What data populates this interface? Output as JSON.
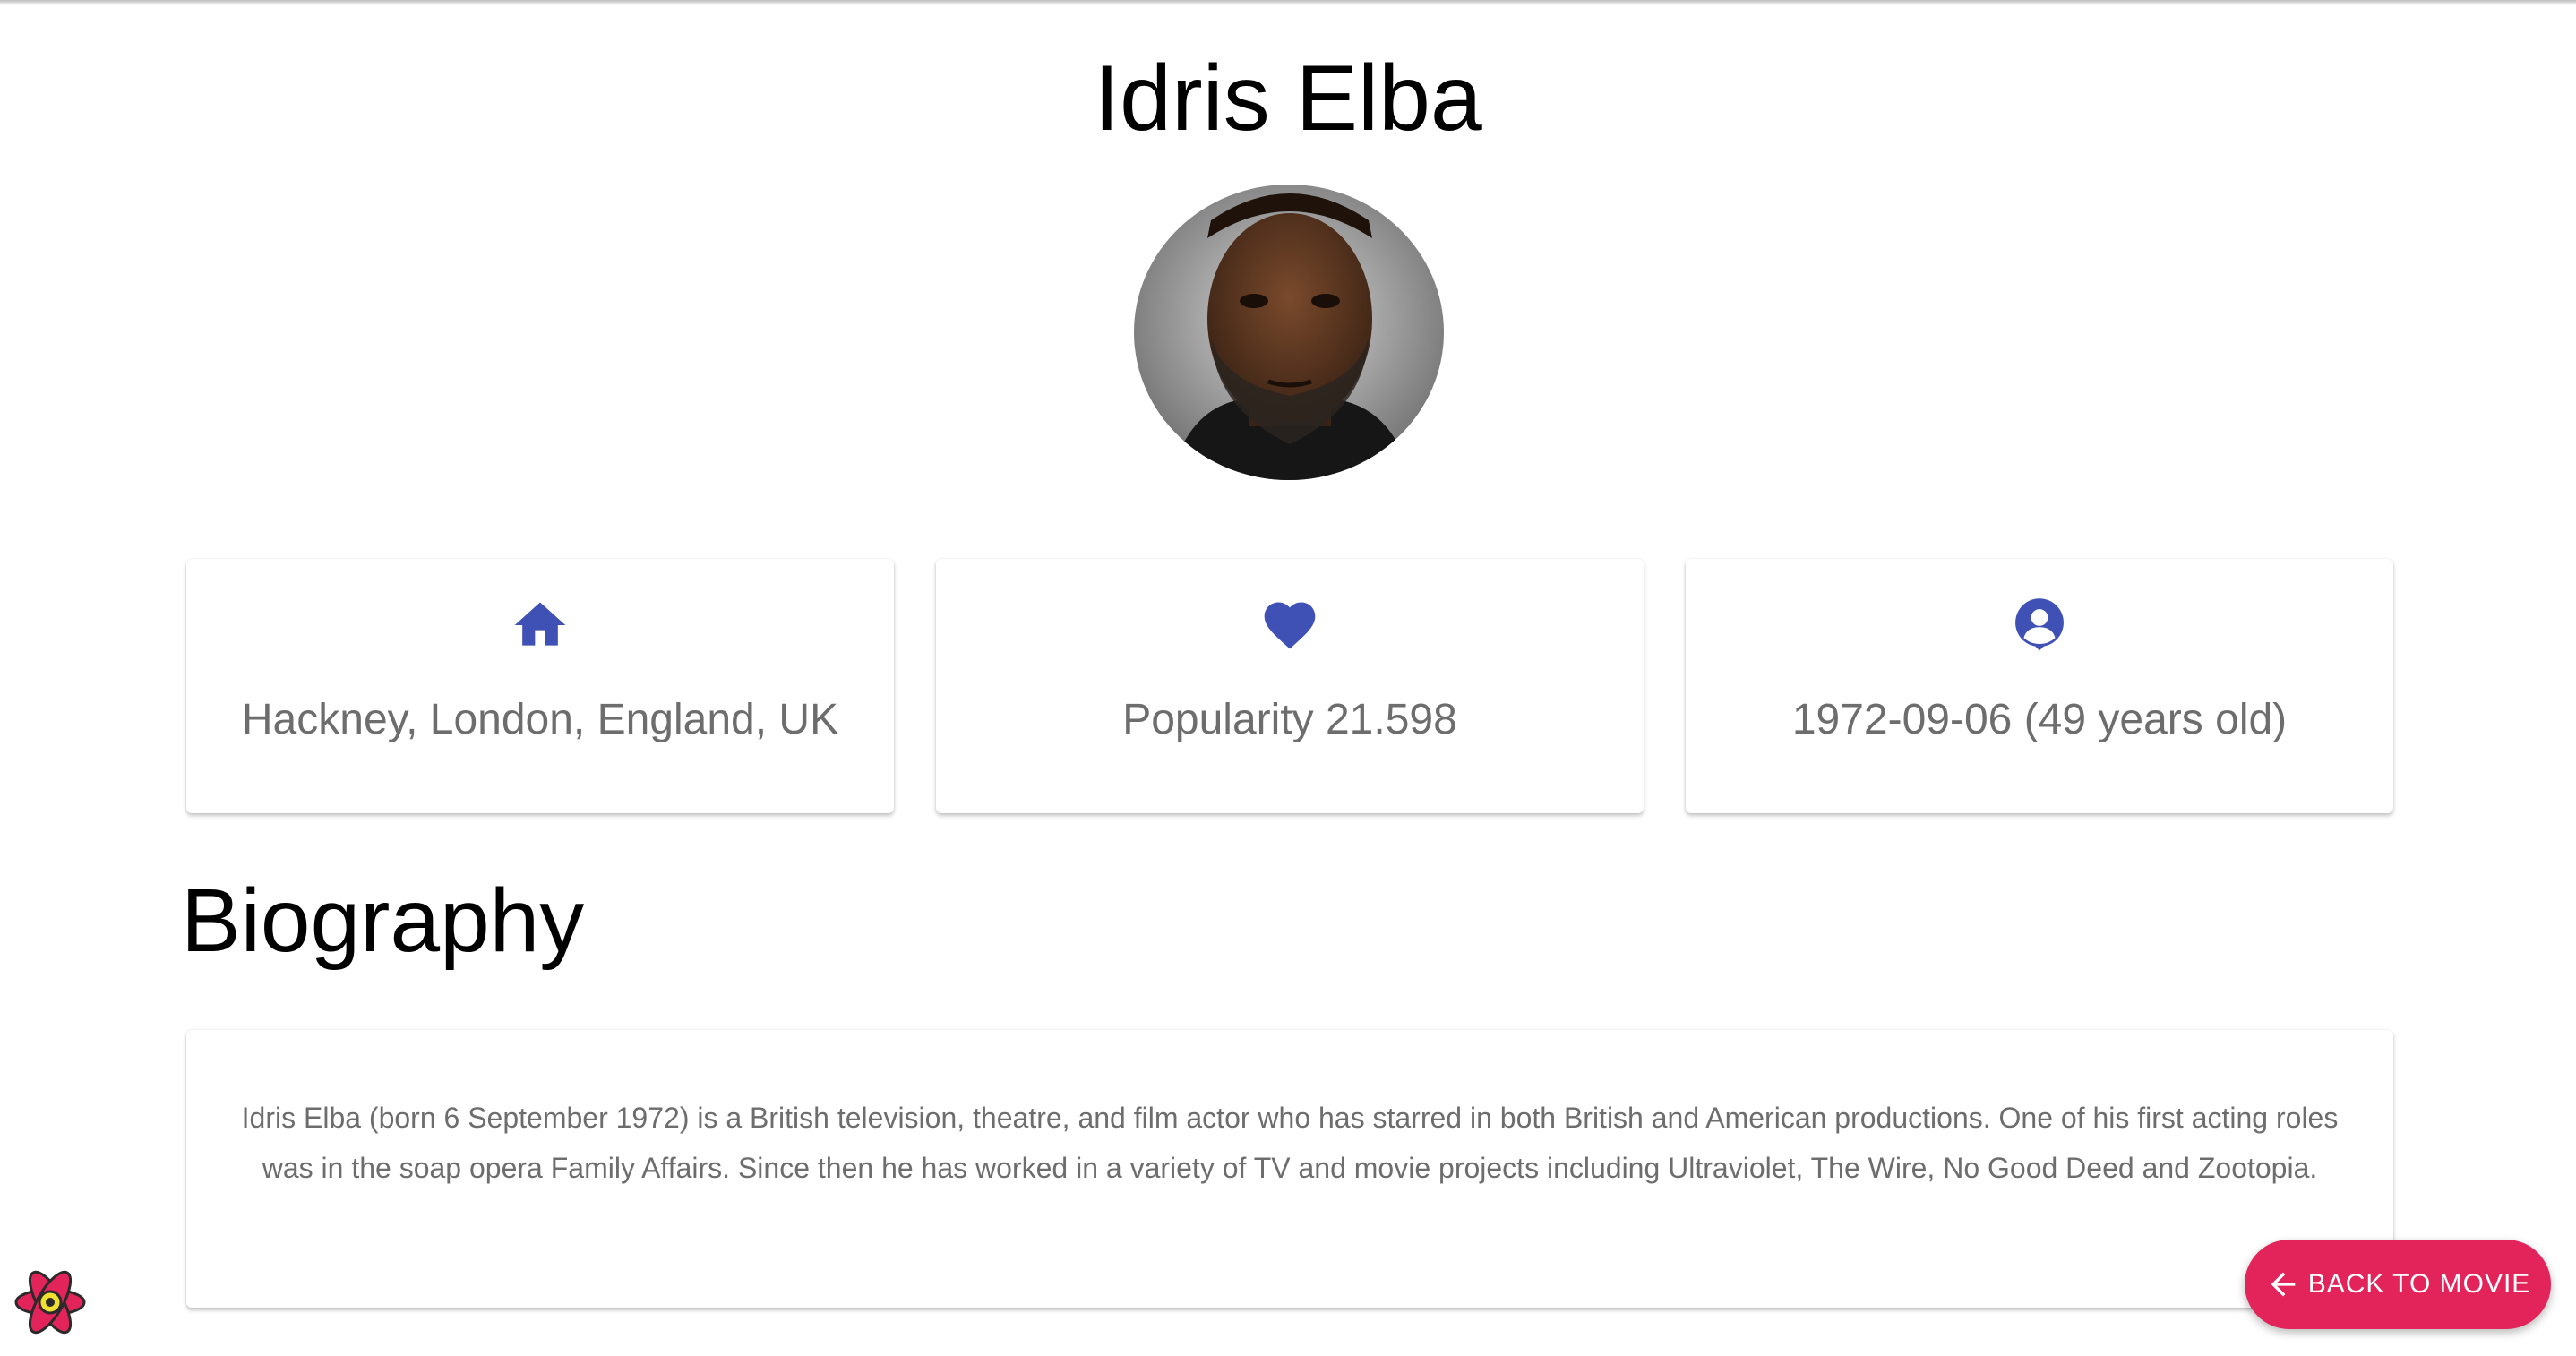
{
  "person": {
    "name": "Idris Elba"
  },
  "info_cards": [
    {
      "icon": "home-icon",
      "text": "Hackney, London, England, UK"
    },
    {
      "icon": "heart-icon",
      "text": "Popularity 21.598"
    },
    {
      "icon": "account-circle-icon",
      "text": "1972-09-06 (49 years old)"
    }
  ],
  "biography": {
    "heading": "Biography",
    "text": "Idris Elba (born 6 September 1972) is a British television, theatre, and film actor who has starred in both British and American productions. One of his first acting roles was in the soap opera Family Affairs. Since then he has worked in a variety of TV and movie projects including Ultraviolet, The Wire, No Good Deed and Zootopia."
  },
  "back_button": {
    "label": "BACK TO MOVIE",
    "icon": "arrow-left-icon"
  },
  "colors": {
    "icon_accent": "#3f51b5",
    "button": "#e2245a"
  }
}
